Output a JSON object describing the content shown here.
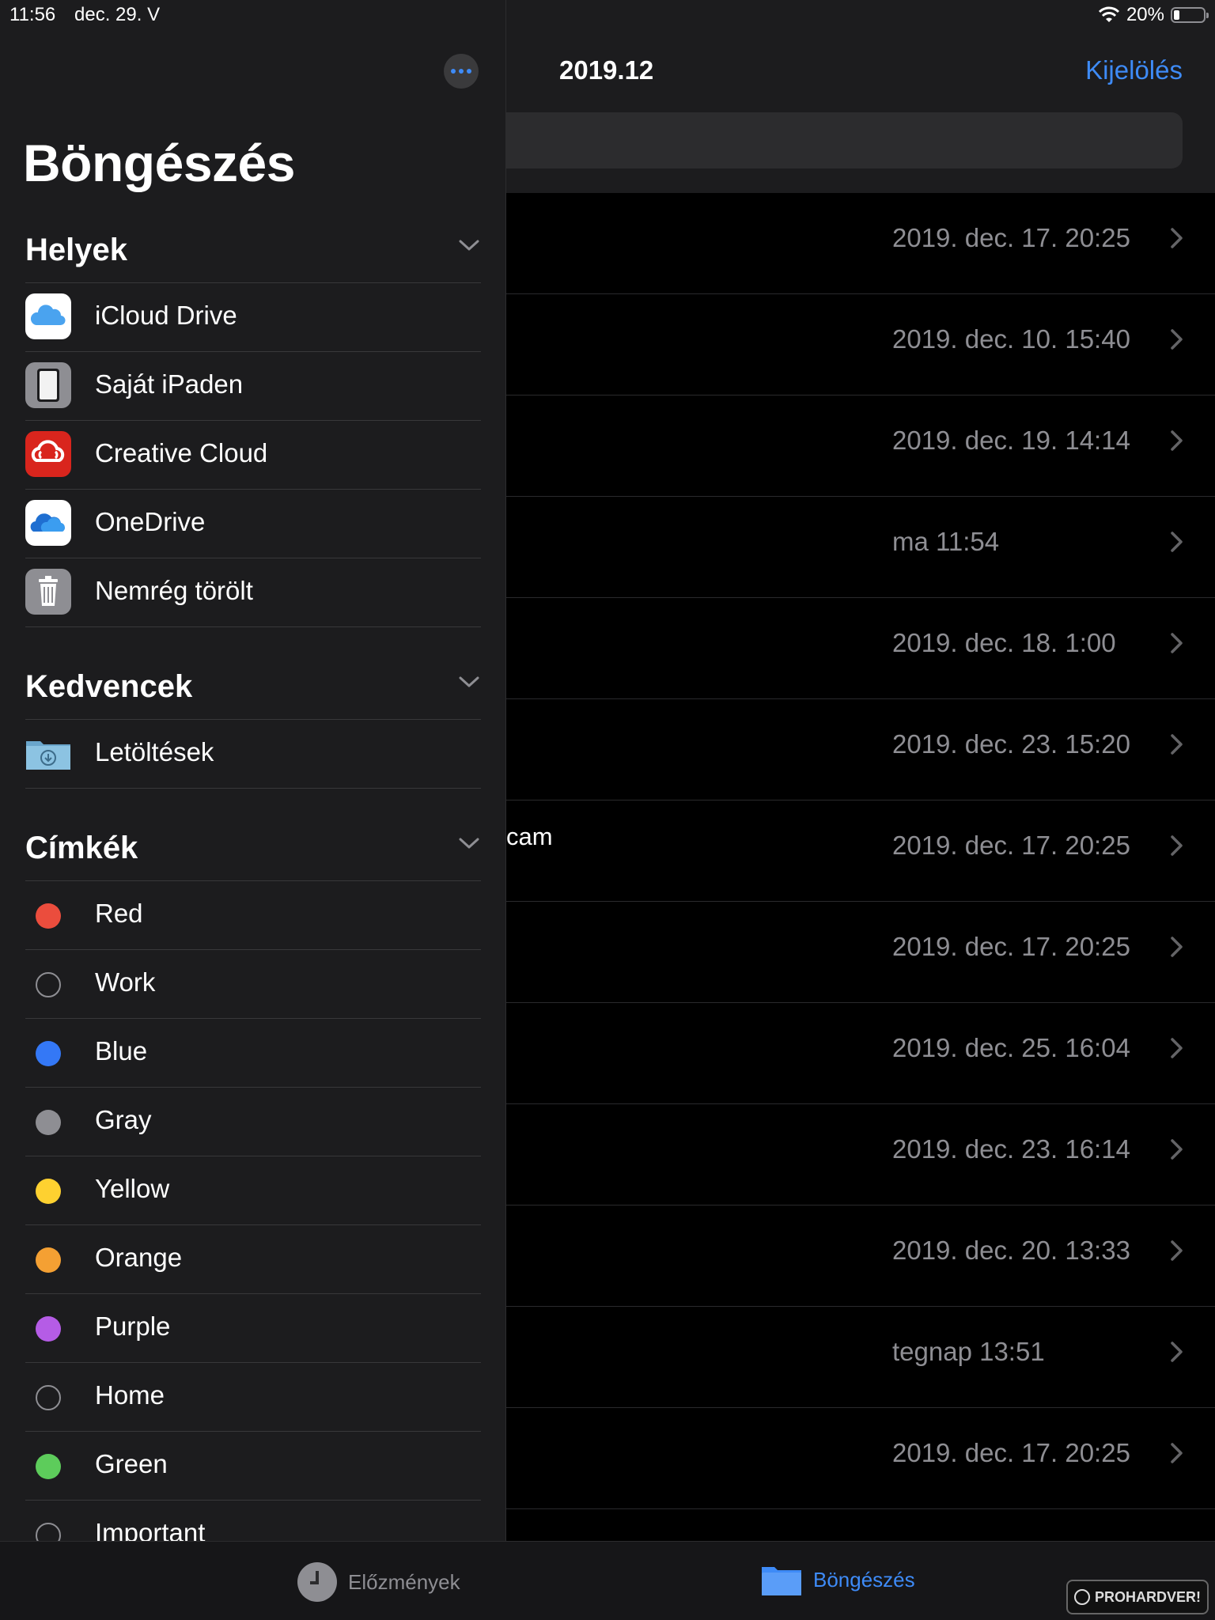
{
  "status_bar": {
    "time": "11:56",
    "date": "dec. 29. V",
    "battery": "20%",
    "battery_level": 0.2,
    "wifi_icon": "wifi-icon"
  },
  "sidebar": {
    "title": "Böngészés",
    "more_icon": "ellipsis-circle-icon",
    "sections": {
      "locations": {
        "title": "Helyek",
        "items": [
          {
            "label": "iCloud Drive",
            "icon": "icloud-drive-icon"
          },
          {
            "label": "Saját iPaden",
            "icon": "ipad-icon"
          },
          {
            "label": "Creative Cloud",
            "icon": "creative-cloud-icon"
          },
          {
            "label": "OneDrive",
            "icon": "onedrive-icon"
          },
          {
            "label": "Nemrég törölt",
            "icon": "trash-icon"
          }
        ]
      },
      "favorites": {
        "title": "Kedvencek",
        "items": [
          {
            "label": "Letöltések",
            "icon": "downloads-folder-icon"
          }
        ]
      },
      "tags": {
        "title": "Címkék",
        "items": [
          {
            "label": "Red",
            "color": "#eb4d3d"
          },
          {
            "label": "Work",
            "color": ""
          },
          {
            "label": "Blue",
            "color": "#3478f6"
          },
          {
            "label": "Gray",
            "color": "#8e8e93"
          },
          {
            "label": "Yellow",
            "color": "#fed130"
          },
          {
            "label": "Orange",
            "color": "#f4a033"
          },
          {
            "label": "Purple",
            "color": "#b55ce6"
          },
          {
            "label": "Home",
            "color": ""
          },
          {
            "label": "Green",
            "color": "#5dcc5b"
          },
          {
            "label": "Important",
            "color": ""
          }
        ]
      }
    }
  },
  "main": {
    "title": "2019.12",
    "select_label": "Kijelölés",
    "files": [
      {
        "name": "",
        "date": "2019. dec. 17. 20:25"
      },
      {
        "name": "",
        "date": "2019. dec. 10. 15:40"
      },
      {
        "name": "",
        "date": "2019. dec. 19. 14:14"
      },
      {
        "name": "",
        "date": "ma 11:54"
      },
      {
        "name": "",
        "date": "2019. dec. 18. 1:00"
      },
      {
        "name": "",
        "date": "2019. dec. 23. 15:20"
      },
      {
        "name": "cam",
        "date": "2019. dec. 17. 20:25"
      },
      {
        "name": "",
        "date": "2019. dec. 17. 20:25"
      },
      {
        "name": "",
        "date": "2019. dec. 25. 16:04"
      },
      {
        "name": "",
        "date": "2019. dec. 23. 16:14"
      },
      {
        "name": "",
        "date": "2019. dec. 20. 13:33"
      },
      {
        "name": "",
        "date": "tegnap 13:51"
      },
      {
        "name": "",
        "date": "2019. dec. 17. 20:25"
      }
    ]
  },
  "tabbar": {
    "recents": {
      "label": "Előzmények",
      "icon": "clock-icon"
    },
    "browse": {
      "label": "Böngészés",
      "icon": "folder-icon"
    }
  },
  "watermark": "PROHARDVER!",
  "colors": {
    "accent": "#3e8bf7",
    "sidebar_bg": "#1c1c1e",
    "secondary_text": "#8e8e93"
  }
}
